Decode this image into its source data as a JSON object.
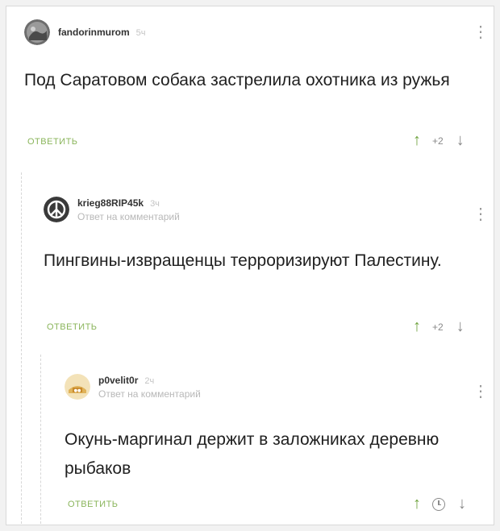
{
  "comments": [
    {
      "author": "fandorinmurom",
      "time": "5ч",
      "reply_to": "",
      "text": "Под Саратовом собака застрелила охотника из ружья",
      "reply_label": "ОТВЕТИТЬ",
      "rating": "+2",
      "avatar_icon": "photo-avatar-icon"
    },
    {
      "author": "krieg88RIP45k",
      "time": "3ч",
      "reply_to": "Ответ на комментарий",
      "text": "Пингвины-извращенцы терроризируют Палестину.",
      "reply_label": "ОТВЕТИТЬ",
      "rating": "+2",
      "avatar_icon": "peace-symbol-icon"
    },
    {
      "author": "p0velit0r",
      "time": "2ч",
      "reply_to": "Ответ на комментарий",
      "text": "Окунь-маргинал держит в заложниках деревню рыбаков",
      "reply_label": "ОТВЕТИТЬ",
      "rating": "",
      "avatar_icon": "gold-avatar-icon"
    }
  ],
  "colors": {
    "accent_green": "#8ab55b",
    "upvote_green": "#6fa33f"
  }
}
